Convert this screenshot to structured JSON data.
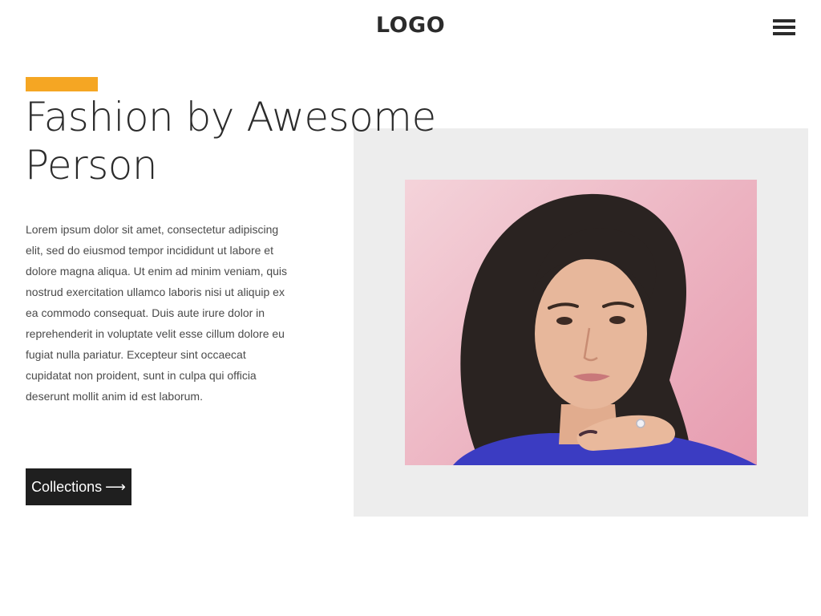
{
  "header": {
    "logo_text": "LOGO",
    "menu_icon": "hamburger-menu-icon"
  },
  "hero": {
    "accent_color": "#f5a623",
    "headline_line1": "Fashion by Awesome",
    "headline_line2": "Person",
    "body": "Lorem ipsum dolor sit amet, consectetur adipiscing elit, sed do eiusmod tempor incididunt ut labore et dolore magna aliqua. Ut enim ad minim veniam, quis nostrud exercitation ullamco laboris nisi ut aliquip ex ea commodo consequat. Duis aute irure dolor in reprehenderit in voluptate velit esse cillum dolore eu fugiat nulla pariatur. Excepteur sint occaecat cupidatat non proident, sunt in culpa qui officia deserunt mollit anim id est laborum.",
    "cta_label": "Collections",
    "cta_arrow": "⟶"
  },
  "colors": {
    "text_dark": "#2b2b2b",
    "button_bg": "#1f1f1f",
    "panel_bg": "#ededed"
  }
}
